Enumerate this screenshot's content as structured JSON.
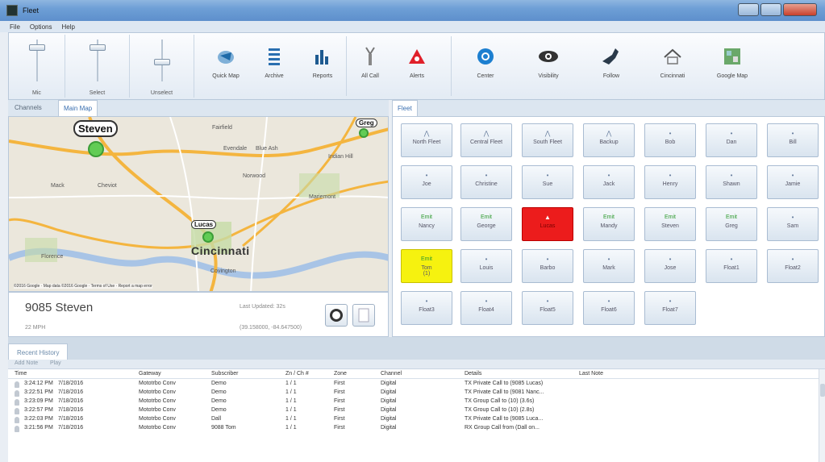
{
  "window": {
    "title": "Fleet"
  },
  "menu": [
    "File",
    "Options",
    "Help"
  ],
  "ribbon": {
    "sliders": [
      "Mic",
      "Select",
      "Unselect"
    ],
    "buttons": [
      {
        "label": "Quick Map",
        "icon": "quick-map-icon"
      },
      {
        "label": "Archive",
        "icon": "archive-icon"
      },
      {
        "label": "Reports",
        "icon": "reports-icon"
      },
      {
        "label": "All Call",
        "icon": "all-call-icon"
      },
      {
        "label": "Alerts",
        "icon": "alerts-icon"
      },
      {
        "label": "Center",
        "icon": "center-icon"
      },
      {
        "label": "Visibility",
        "icon": "visibility-icon"
      },
      {
        "label": "Follow",
        "icon": "follow-icon"
      },
      {
        "label": "Cincinnati",
        "icon": "home-icon"
      },
      {
        "label": "Google Map",
        "icon": "google-map-icon"
      }
    ]
  },
  "left_tabs": [
    "Channels",
    "Main Map"
  ],
  "map": {
    "markers": {
      "steven": "Steven",
      "greg": "Greg",
      "lucas": "Lucas"
    },
    "city": "Cincinnati",
    "places": [
      "Mack",
      "Cheviot",
      "Fairfield",
      "Evendale",
      "Blue Ash",
      "Indian Hill",
      "Norwood",
      "Mariemont",
      "Covington",
      "Florence"
    ],
    "credit": "©2016 Google · Map data ©2016 Google · Terms of Use · Report a map error"
  },
  "info": {
    "name": "9085 Steven",
    "speed": "22 MPH",
    "updated": "Last Updated: 32s",
    "coords": "(39.158000, -84.647500)"
  },
  "right_tabs": [
    "Fleet"
  ],
  "fleet": [
    {
      "label": "North Fleet",
      "icon": "⋀",
      "state": "normal"
    },
    {
      "label": "Central Fleet",
      "icon": "⋀",
      "state": "normal"
    },
    {
      "label": "South Fleet",
      "icon": "⋀",
      "state": "normal"
    },
    {
      "label": "Backup",
      "icon": "⋀",
      "state": "normal"
    },
    {
      "label": "Bob",
      "icon": "•",
      "state": "normal"
    },
    {
      "label": "Dan",
      "icon": "•",
      "state": "normal"
    },
    {
      "label": "Bill",
      "icon": "•",
      "state": "normal"
    },
    {
      "label": "Joe",
      "icon": "•",
      "state": "normal"
    },
    {
      "label": "Christine",
      "icon": "•",
      "state": "normal"
    },
    {
      "label": "Sue",
      "icon": "•",
      "state": "normal"
    },
    {
      "label": "Jack",
      "icon": "•",
      "state": "normal"
    },
    {
      "label": "Henry",
      "icon": "•",
      "state": "normal"
    },
    {
      "label": "Shawn",
      "icon": "•",
      "state": "normal"
    },
    {
      "label": "Jamie",
      "icon": "•",
      "state": "normal"
    },
    {
      "label": "Nancy",
      "icon": "Emit",
      "state": "green"
    },
    {
      "label": "George",
      "icon": "Emit",
      "state": "green"
    },
    {
      "label": "Lucas",
      "icon": "▲",
      "state": "red"
    },
    {
      "label": "Mandy",
      "icon": "Emit",
      "state": "green"
    },
    {
      "label": "Steven",
      "icon": "Emit",
      "state": "green"
    },
    {
      "label": "Greg",
      "icon": "Emit",
      "state": "green"
    },
    {
      "label": "Sam",
      "icon": "•",
      "state": "normal"
    },
    {
      "label": "Tom",
      "icon": "Emit",
      "state": "yellow",
      "extra": "(1)"
    },
    {
      "label": "Louis",
      "icon": "•",
      "state": "normal"
    },
    {
      "label": "Barbo",
      "icon": "•",
      "state": "normal"
    },
    {
      "label": "Mark",
      "icon": "•",
      "state": "normal"
    },
    {
      "label": "Jose",
      "icon": "•",
      "state": "normal"
    },
    {
      "label": "Float1",
      "icon": "•",
      "state": "normal"
    },
    {
      "label": "Float2",
      "icon": "•",
      "state": "normal"
    },
    {
      "label": "Float3",
      "icon": "•",
      "state": "normal"
    },
    {
      "label": "Float4",
      "icon": "•",
      "state": "normal"
    },
    {
      "label": "Float5",
      "icon": "•",
      "state": "normal"
    },
    {
      "label": "Float6",
      "icon": "•",
      "state": "normal"
    },
    {
      "label": "Float7",
      "icon": "•",
      "state": "normal"
    }
  ],
  "history": {
    "tab": "Recent History",
    "toolbar": [
      "Add Note",
      "Play"
    ],
    "columns": [
      "Time",
      "Gateway",
      "Subscriber",
      "Zn / Ch #",
      "Zone",
      "Channel",
      "Details",
      "Last Note"
    ],
    "rows": [
      [
        "3:24:12 PM",
        "7/18/2016",
        "Mototrbo Conv",
        "Demo",
        "1 / 1",
        "First",
        "Digital",
        "TX Private Call to (9085 Lucas)",
        ""
      ],
      [
        "3:22:51 PM",
        "7/18/2016",
        "Mototrbo Conv",
        "Demo",
        "1 / 1",
        "First",
        "Digital",
        "TX Private Call to (9081 Nanc...",
        ""
      ],
      [
        "3:23:09 PM",
        "7/18/2016",
        "Mototrbo Conv",
        "Demo",
        "1 / 1",
        "First",
        "Digital",
        "TX Group Call to (10)  (3.6s)",
        ""
      ],
      [
        "3:22:57 PM",
        "7/18/2016",
        "Mototrbo Conv",
        "Demo",
        "1 / 1",
        "First",
        "Digital",
        "TX Group Call to (10)  (2.8s)",
        ""
      ],
      [
        "3:22:03 PM",
        "7/18/2016",
        "Mototrbo Conv",
        "Dall",
        "1 / 1",
        "First",
        "Digital",
        "TX Private Call to (9085 Luca...",
        ""
      ],
      [
        "3:21:56 PM",
        "7/18/2016",
        "Mototrbo Conv",
        "9088 Tom",
        "1 / 1",
        "First",
        "Digital",
        "RX Group Call from (Dall on...",
        ""
      ]
    ]
  },
  "colors": {
    "alert": "#ec1c1c",
    "pending": "#f6f20f",
    "online": "#2d9a2d",
    "accent": "#3a6fb0"
  }
}
